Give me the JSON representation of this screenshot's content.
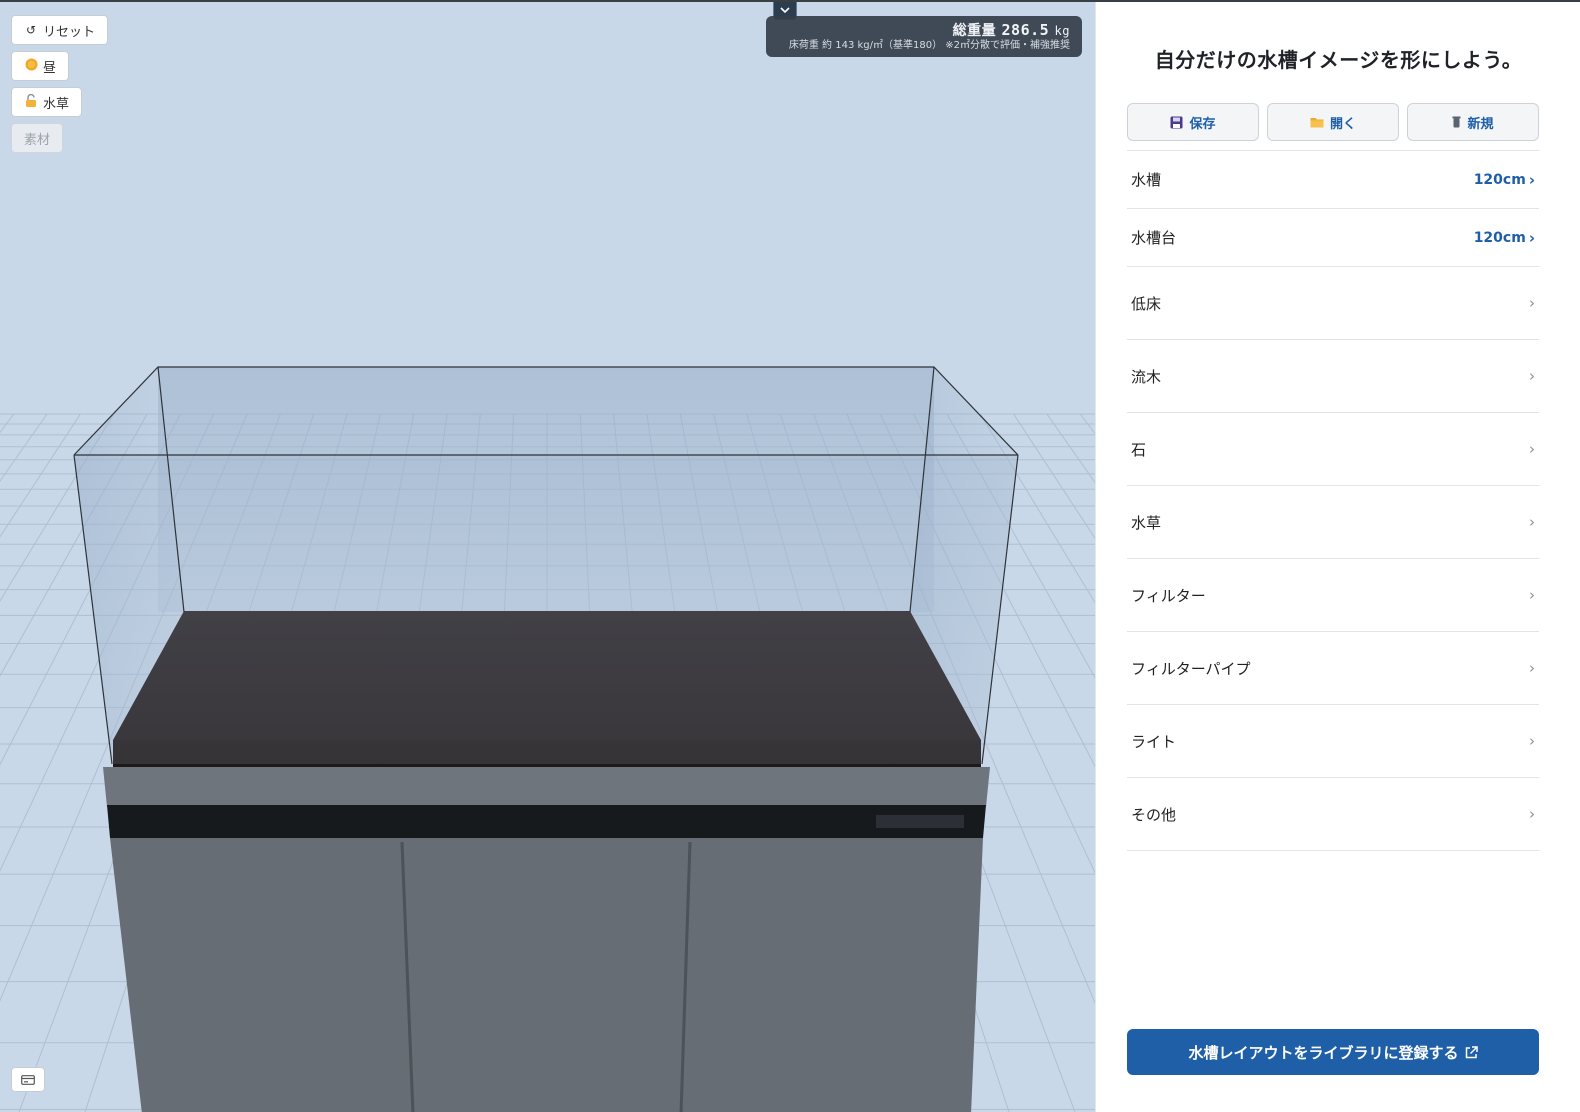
{
  "toolbar": {
    "reset_label": "リセット",
    "day_label": "昼",
    "plants_label": "水草",
    "material_label": "素材"
  },
  "weight": {
    "title": "総重量",
    "value": "286.5",
    "unit": "kg",
    "sub": "床荷重 約 143 kg/㎡（基準180） ※2㎡分散で評価・補強推奨"
  },
  "panel": {
    "headline": "自分だけの水槽イメージを形にしよう。",
    "actions": {
      "save": "保存",
      "open": "開く",
      "new": "新規"
    },
    "menu": [
      {
        "label": "水槽",
        "value": "120cm"
      },
      {
        "label": "水槽台",
        "value": "120cm"
      },
      {
        "label": "低床"
      },
      {
        "label": "流木"
      },
      {
        "label": "石"
      },
      {
        "label": "水草"
      },
      {
        "label": "フィルター"
      },
      {
        "label": "フィルターパイプ"
      },
      {
        "label": "ライト"
      },
      {
        "label": "その他"
      }
    ],
    "register_label": "水槽レイアウトをライブラリに登録する"
  },
  "colors": {
    "accent": "#1f5fa8",
    "viewport_bg": "#c9d8e8",
    "substrate": "#221c1c",
    "cabinet": "#6b7178"
  },
  "icons": {
    "reset": "reset-icon",
    "day": "sun-icon",
    "plants": "lock-open-icon",
    "collapse": "chevron-down-icon",
    "save": "floppy-disk-icon",
    "open": "folder-icon",
    "new": "trash-icon",
    "card": "card-icon",
    "external": "external-link-icon"
  }
}
